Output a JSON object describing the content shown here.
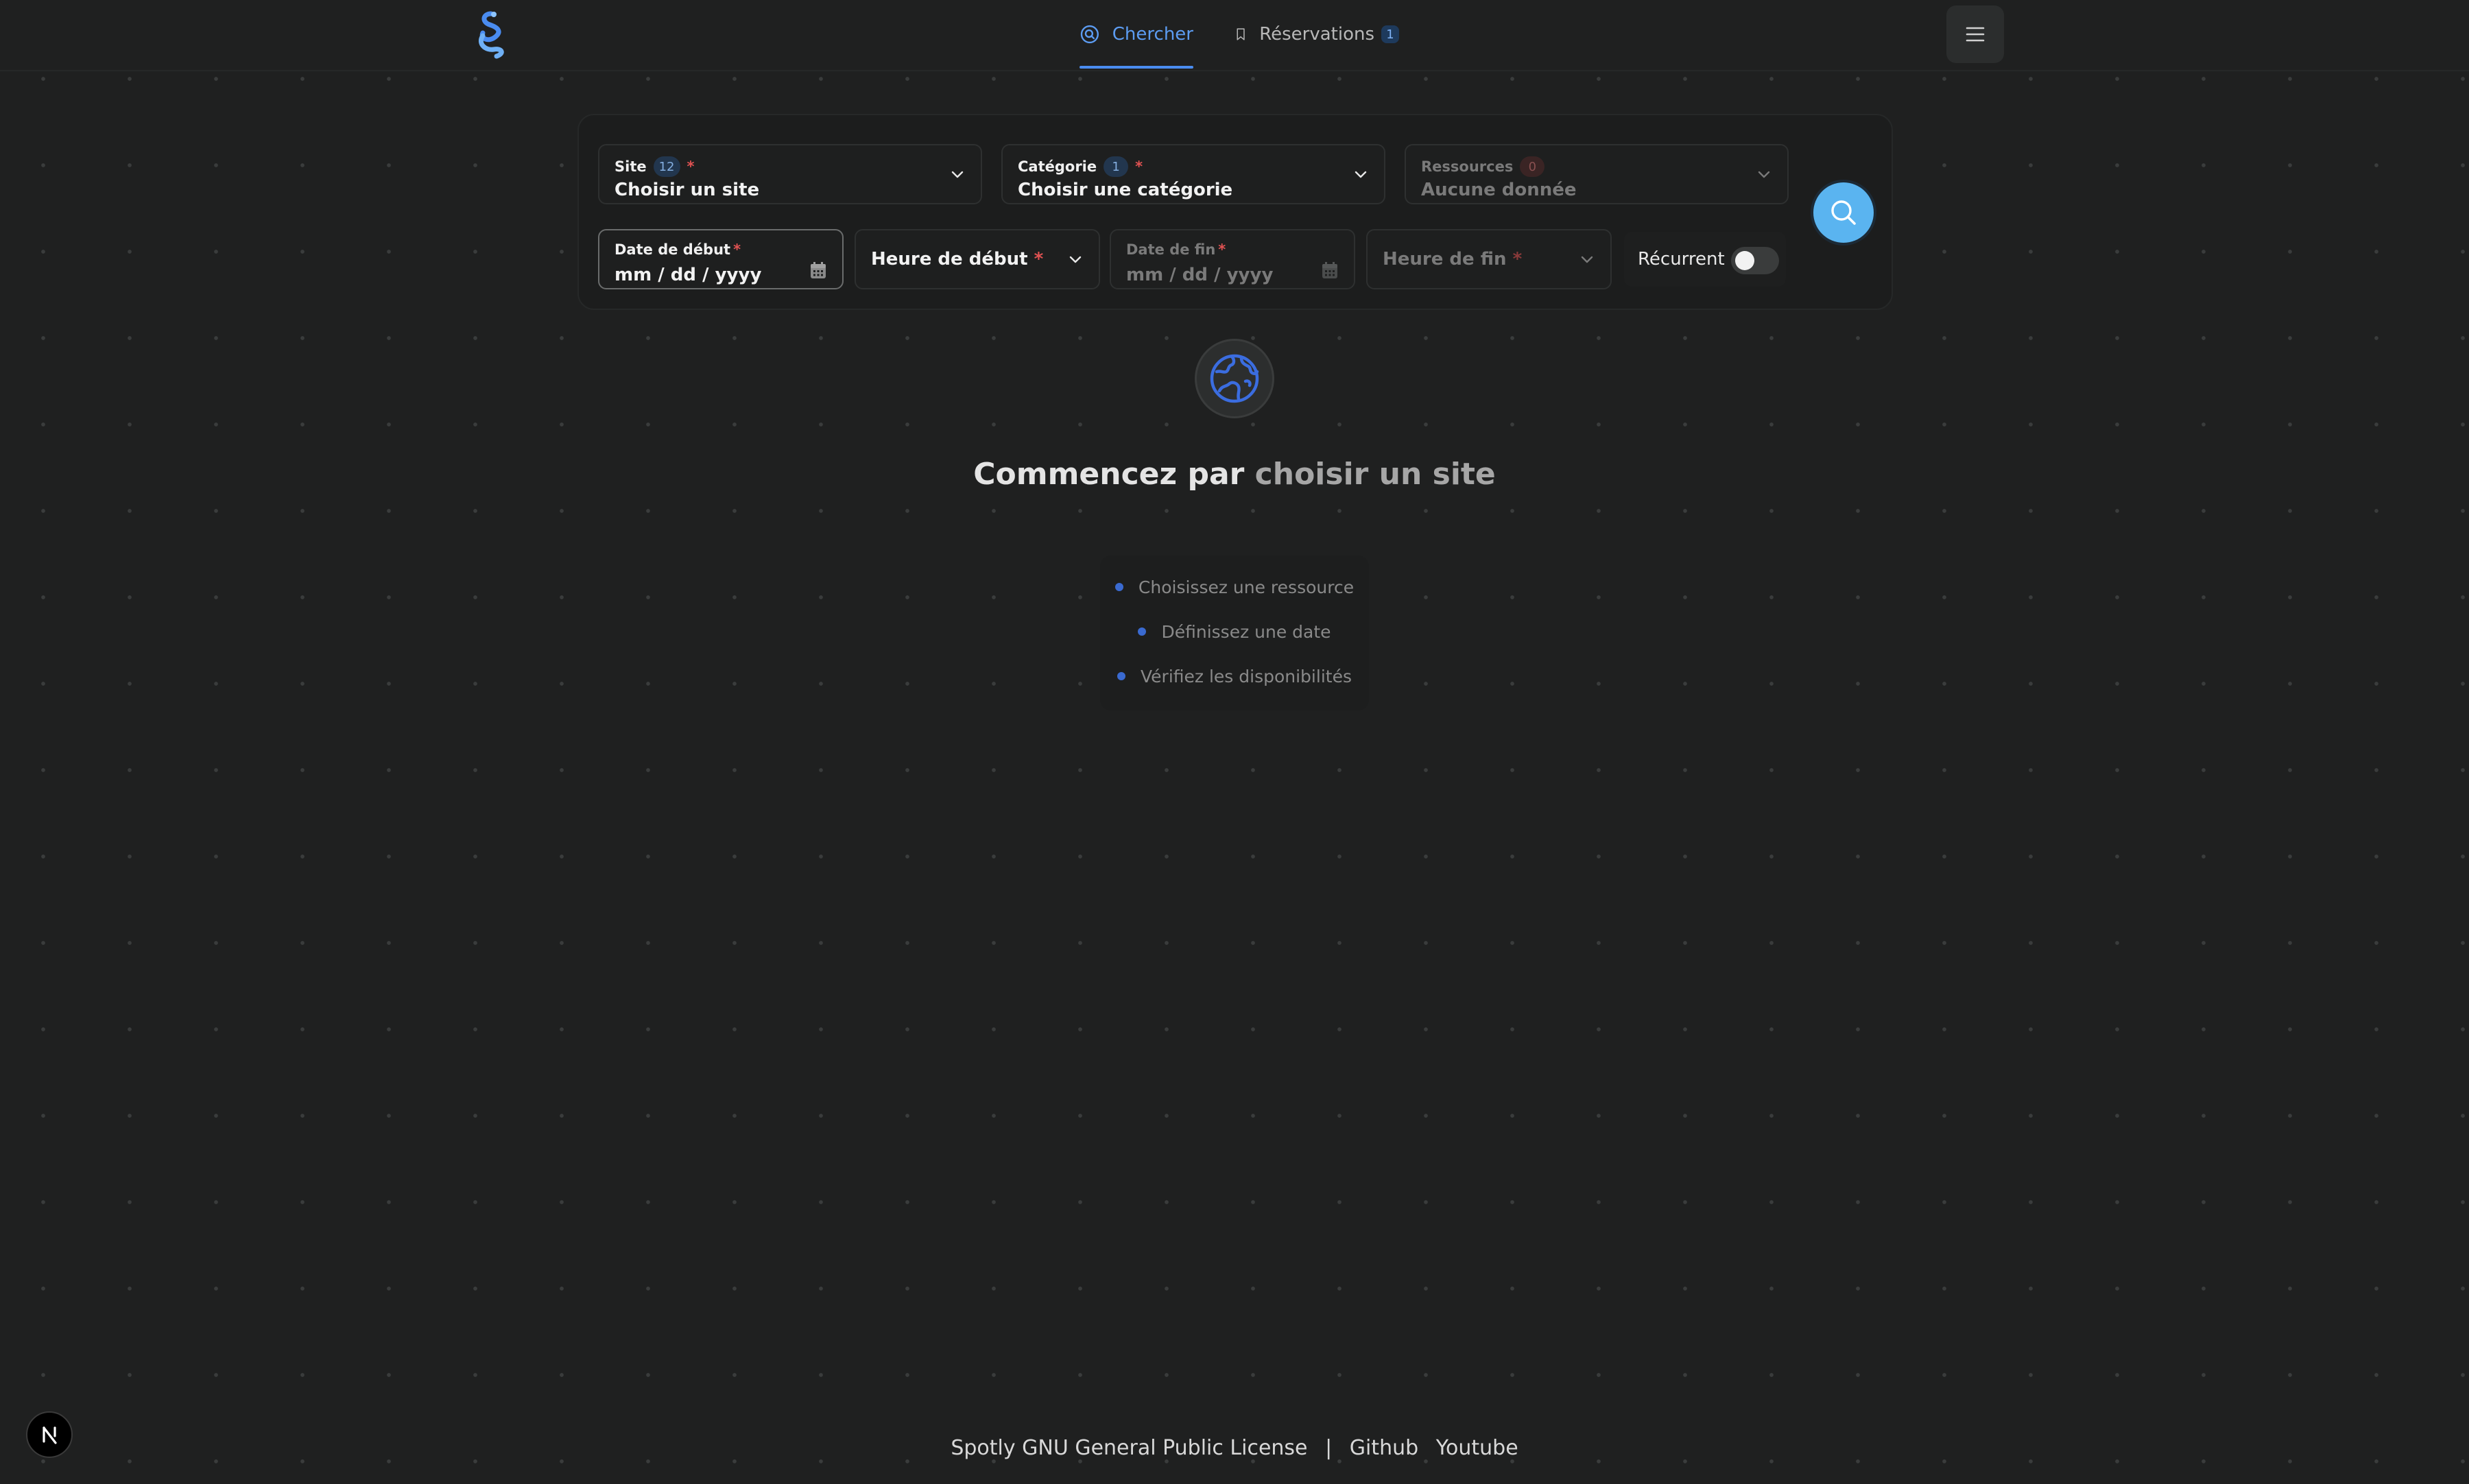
{
  "header": {
    "tabs": [
      {
        "label": "Chercher",
        "active": true,
        "icon": "search-circle-icon"
      },
      {
        "label": "Réservations",
        "active": false,
        "badge": "1",
        "icon": "bookmark-icon"
      }
    ]
  },
  "search": {
    "site": {
      "label": "Site",
      "count": "12",
      "required": "*",
      "value": "Choisir un site"
    },
    "category": {
      "label": "Catégorie",
      "count": "1",
      "required": "*",
      "value": "Choisir une catégorie"
    },
    "resources": {
      "label": "Ressources",
      "count": "0",
      "value": "Aucune donnée"
    },
    "start_date": {
      "label": "Date de début",
      "required": "*",
      "value": "mm / dd / yyyy"
    },
    "start_time": {
      "label": "Heure de début",
      "required": "*"
    },
    "end_date": {
      "label": "Date de fin",
      "required": "*",
      "value": "mm / dd / yyyy"
    },
    "end_time": {
      "label": "Heure de fin",
      "required": "*"
    },
    "recurrent": {
      "label": "Récurrent",
      "checked": false
    }
  },
  "empty_state": {
    "title_start": "Commencez par ",
    "title_end": "choisir un site",
    "steps": [
      "Choisissez une ressource",
      "Définissez une date",
      "Vérifiez les disponibilités"
    ]
  },
  "footer": {
    "license": "Spotly GNU General Public License",
    "separator": "|",
    "links": [
      "Github",
      "Youtube"
    ]
  },
  "colors": {
    "accent": "#4a8cf0",
    "search_button": "#5ab4f0",
    "required": "#e05252",
    "background": "#1f2020"
  }
}
